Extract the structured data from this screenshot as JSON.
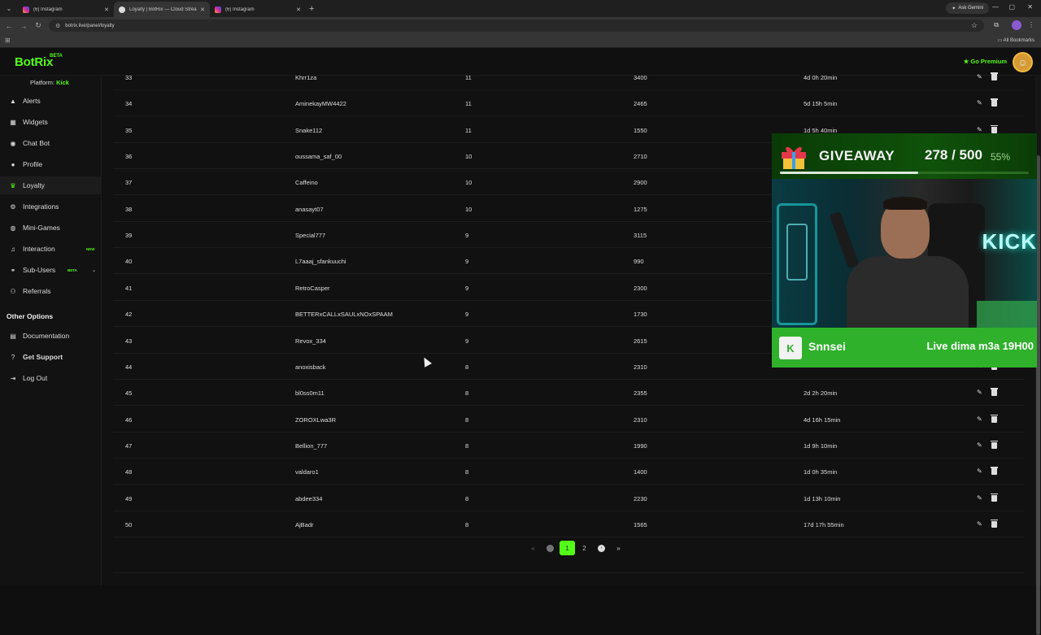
{
  "browser": {
    "tabs": [
      {
        "label": "(6) Instagram",
        "active": false
      },
      {
        "label": "Loyalty | BotRix — Cloud Stream",
        "active": true
      },
      {
        "label": "(6) Instagram",
        "active": false
      }
    ],
    "new_tab": "+",
    "ask_gemini": "Ask Gemini",
    "url": "botrix.live/panel/loyalty",
    "all_bookmarks": "All Bookmarks"
  },
  "header": {
    "logo": "BotRix",
    "logo_badge": "BETA",
    "go_premium": "Go Premium"
  },
  "sidebar": {
    "platform_label": "Platform:",
    "platform_value": "Kick",
    "items": [
      {
        "label": "Alerts",
        "icon": "warning-icon"
      },
      {
        "label": "Widgets",
        "icon": "grid-icon"
      },
      {
        "label": "Chat Bot",
        "icon": "robot-icon"
      },
      {
        "label": "Profile",
        "icon": "user-icon"
      },
      {
        "label": "Loyalty",
        "icon": "trophy-icon",
        "active": true
      },
      {
        "label": "Integrations",
        "icon": "integration-icon"
      },
      {
        "label": "Mini-Games",
        "icon": "gamepad-icon"
      },
      {
        "label": "Interaction",
        "icon": "music-icon",
        "badge": "NEW"
      },
      {
        "label": "Sub-Users",
        "icon": "users-icon",
        "badge": "BETA"
      },
      {
        "label": "Referrals",
        "icon": "referral-icon"
      }
    ],
    "section_title": "Other Options",
    "other_items": [
      {
        "label": "Documentation",
        "icon": "book-icon"
      },
      {
        "label": "Get Support",
        "icon": "help-icon"
      },
      {
        "label": "Log Out",
        "icon": "logout-icon"
      }
    ]
  },
  "table": {
    "rows": [
      {
        "rank": "33",
        "user": "Khrr1za",
        "col3": "11",
        "col4": "3400",
        "time": "4d 0h 20min"
      },
      {
        "rank": "34",
        "user": "AminekayMW4422",
        "col3": "11",
        "col4": "2465",
        "time": "5d 15h 5min"
      },
      {
        "rank": "35",
        "user": "Snake112",
        "col3": "11",
        "col4": "1550",
        "time": "1d 5h 40min"
      },
      {
        "rank": "36",
        "user": "oussama_saf_00",
        "col3": "10",
        "col4": "2710",
        "time": ""
      },
      {
        "rank": "37",
        "user": "Caffeino",
        "col3": "10",
        "col4": "2900",
        "time": ""
      },
      {
        "rank": "38",
        "user": "anasayt07",
        "col3": "10",
        "col4": "1275",
        "time": ""
      },
      {
        "rank": "39",
        "user": "Special777",
        "col3": "9",
        "col4": "3115",
        "time": ""
      },
      {
        "rank": "40",
        "user": "L7aaaj_sfankuuchi",
        "col3": "9",
        "col4": "990",
        "time": ""
      },
      {
        "rank": "41",
        "user": "RetroCasper",
        "col3": "9",
        "col4": "2300",
        "time": ""
      },
      {
        "rank": "42",
        "user": "BETTERxCALLxSAULxNOxSPAAM",
        "col3": "9",
        "col4": "1730",
        "time": ""
      },
      {
        "rank": "43",
        "user": "Revox_334",
        "col3": "9",
        "col4": "2615",
        "time": ""
      },
      {
        "rank": "44",
        "user": "anoxisback",
        "col3": "8",
        "col4": "2310",
        "time": ""
      },
      {
        "rank": "45",
        "user": "bl0ss0m11",
        "col3": "8",
        "col4": "2355",
        "time": "2d 2h 20min"
      },
      {
        "rank": "46",
        "user": "ZOROXLwa3R",
        "col3": "8",
        "col4": "2310",
        "time": "4d 16h 15min"
      },
      {
        "rank": "47",
        "user": "Bellion_777",
        "col3": "8",
        "col4": "1990",
        "time": "1d 9h 10min"
      },
      {
        "rank": "48",
        "user": "valdaro1",
        "col3": "8",
        "col4": "1400",
        "time": "1d 0h 35min"
      },
      {
        "rank": "49",
        "user": "abdee334",
        "col3": "8",
        "col4": "2230",
        "time": "1d 13h 10min"
      },
      {
        "rank": "50",
        "user": "AjBadr",
        "col3": "8",
        "col4": "1565",
        "time": "17d 17h 55min"
      }
    ]
  },
  "pagination": {
    "first": "«",
    "prev": "‹",
    "current": "1",
    "page2": "2",
    "next": "›",
    "last": "»"
  },
  "overlay": {
    "giveaway_title": "GIVEAWAY",
    "count": "278 / 500",
    "percent": "55%",
    "progress": 0.556,
    "cam_sign": "KICK",
    "kick_logo": "K",
    "streamer": "Snnsei",
    "message": "Live dima m3a 19H00"
  },
  "colors": {
    "accent": "#53fc18",
    "overlay_green": "#2fb12c"
  }
}
